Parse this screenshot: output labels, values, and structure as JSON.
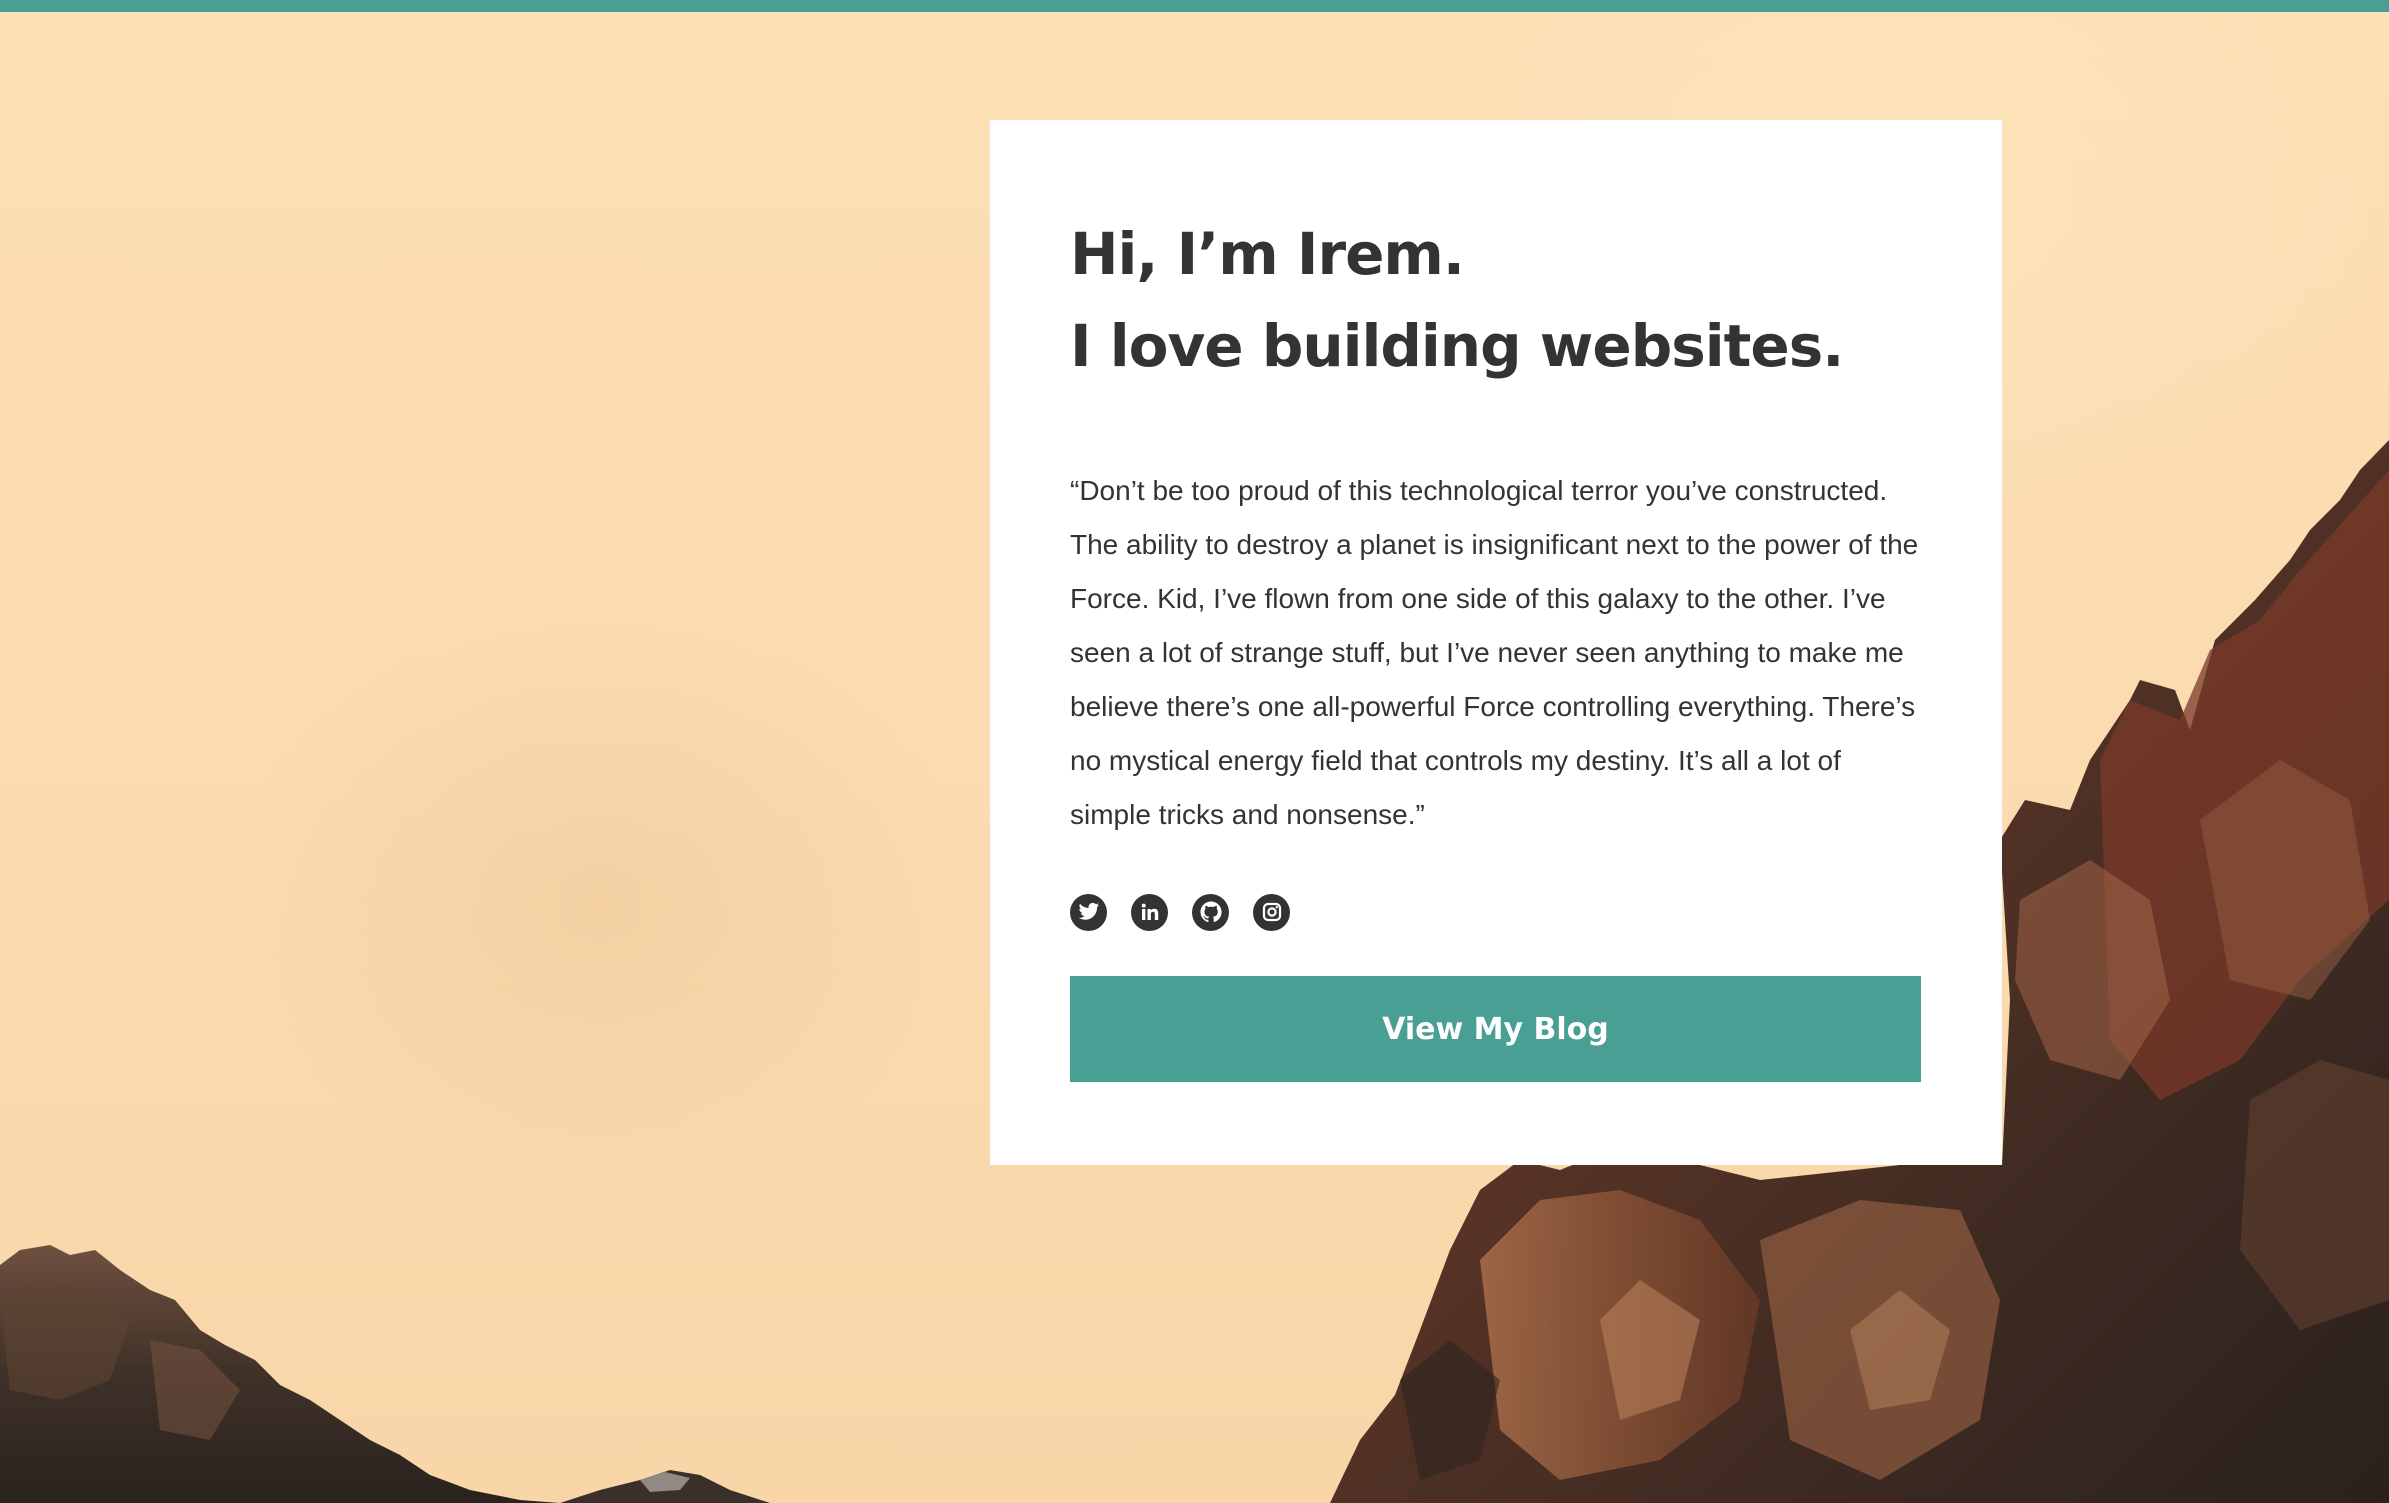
{
  "colors": {
    "accent": "#4a9f94",
    "sky": "#fbdcb0",
    "text": "#333333",
    "card": "#ffffff"
  },
  "hero": {
    "headline_line1": "Hi, I’m Irem.",
    "headline_line2": "I love building websites.",
    "quote": "“Don’t be too proud of this technological terror you’ve constructed. The ability to destroy a planet is insignificant next to the power of the Force. Kid, I’ve flown from one side of this galaxy to the other. I’ve seen a lot of strange stuff, but I’ve never seen anything to make me believe there’s one all-powerful Force controlling everything. There’s no mystical energy field that controls my destiny. It’s all a lot of simple tricks and nonsense.”",
    "social_icons": [
      "twitter-icon",
      "linkedin-icon",
      "github-icon",
      "instagram-icon"
    ],
    "button_label": "View My Blog"
  }
}
